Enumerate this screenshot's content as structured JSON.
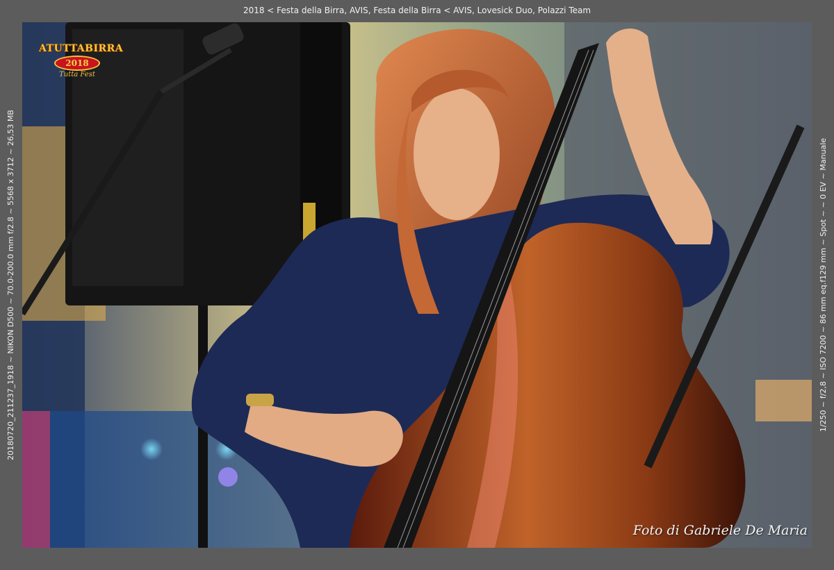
{
  "caption": {
    "top": "2018 < Festa della Birra, AVIS, Festa della Birra < AVIS, Lovesick Duo, Polazzi Team",
    "left": "20180720_211237_1918 ~ NIKON D500 ~ 70.0-200.0 mm f/2.8 ~ 5568 x 3712 ~ 26,53 MB",
    "right": "1/250 ~ f/2,8 ~ ISO 7200 ~ 86 mm eq.f129 mm ~ Spot ~ ~ 0 EV ~ Manuale"
  },
  "logo": {
    "top": "ATUTTABIRRA",
    "year": "2018",
    "sub": "Tutta Fest"
  },
  "credit": "Foto di Gabriele De Maria",
  "colors": {
    "frame": "#5c5c5c",
    "dress": "#1d2a55",
    "hair": "#c86a3a",
    "bass": "#a8521c",
    "logo_red": "#c8141c",
    "logo_gold": "#f3c241"
  }
}
